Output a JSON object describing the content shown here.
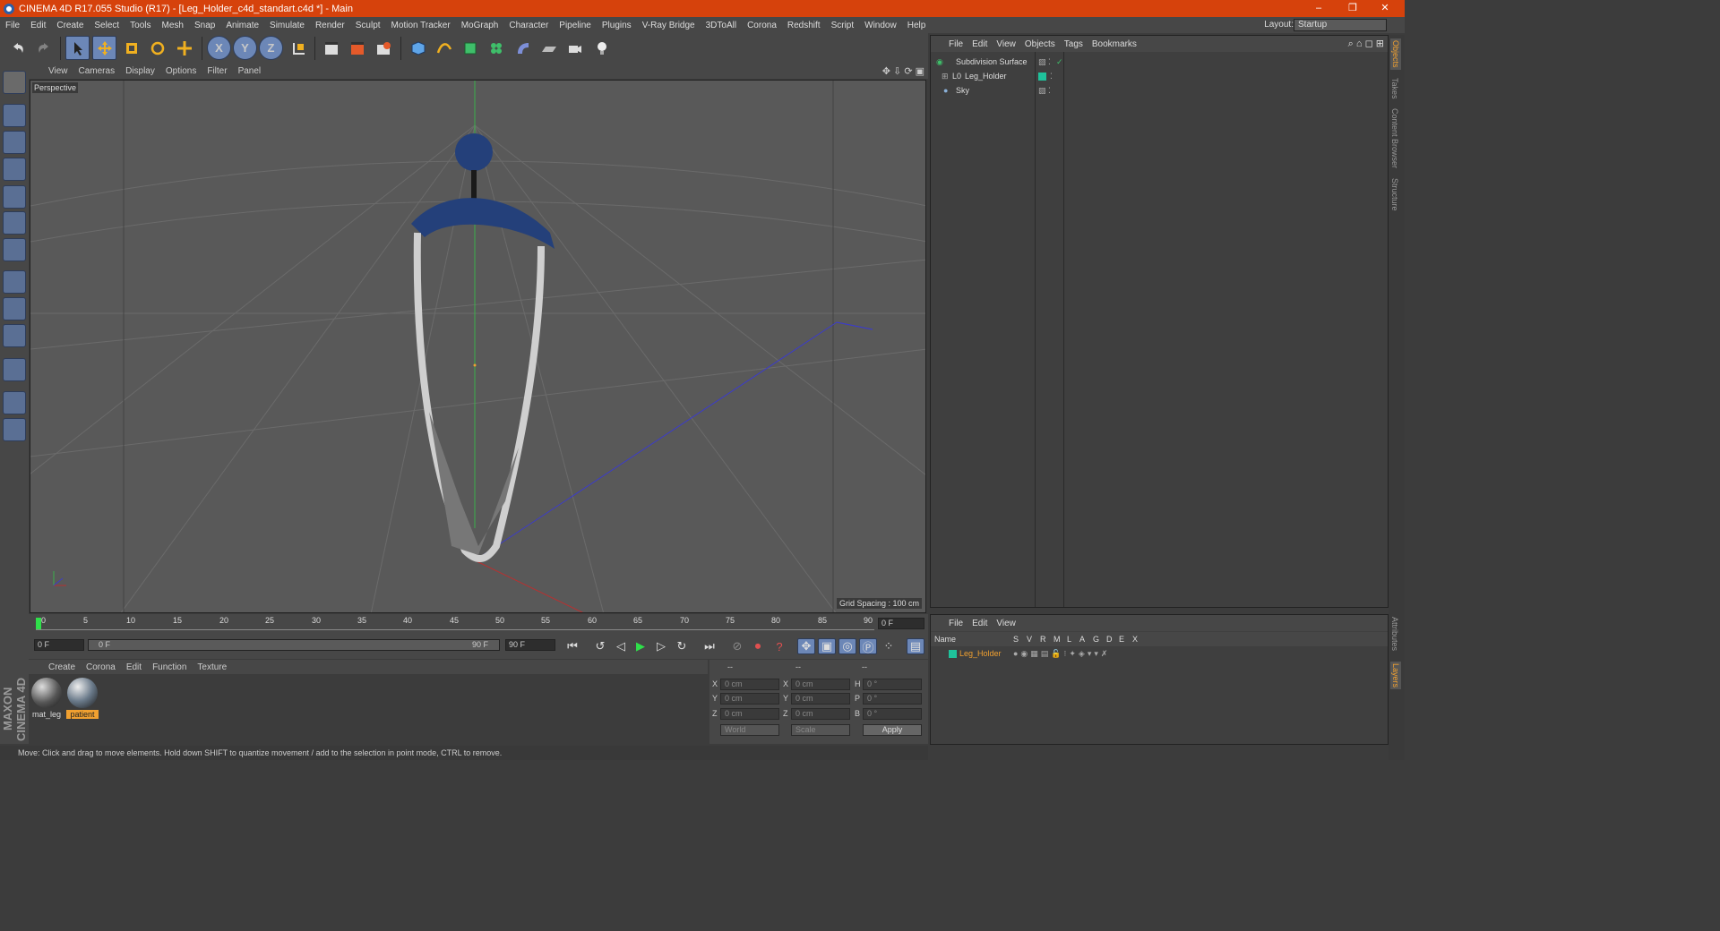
{
  "window": {
    "title": "CINEMA 4D R17.055 Studio (R17) - [Leg_Holder_c4d_standart.c4d *] - Main",
    "minimize": "–",
    "maximize": "❐",
    "close": "✕"
  },
  "menubar": {
    "items": [
      "File",
      "Edit",
      "Create",
      "Select",
      "Tools",
      "Mesh",
      "Snap",
      "Animate",
      "Simulate",
      "Render",
      "Sculpt",
      "Motion Tracker",
      "MoGraph",
      "Character",
      "Pipeline",
      "Plugins",
      "V-Ray Bridge",
      "3DToAll",
      "Corona",
      "Redshift",
      "Script",
      "Window",
      "Help"
    ],
    "layout_label": "Layout:",
    "layout_value": "Startup"
  },
  "toolbar": {
    "axis_x": "X",
    "axis_y": "Y",
    "axis_z": "Z"
  },
  "viewport": {
    "menu": [
      "View",
      "Cameras",
      "Display",
      "Options",
      "Filter",
      "Panel"
    ],
    "label": "Perspective",
    "grid_spacing": "Grid Spacing : 100 cm"
  },
  "timeline": {
    "ticks": [
      "0",
      "5",
      "10",
      "15",
      "20",
      "25",
      "30",
      "35",
      "40",
      "45",
      "50",
      "55",
      "60",
      "65",
      "70",
      "75",
      "80",
      "85",
      "90"
    ],
    "current_frame": "0 F",
    "start": "0 F",
    "range_start": "0 F",
    "range_end": "90 F",
    "end": "90 F"
  },
  "materials": {
    "menu": [
      "Create",
      "Corona",
      "Edit",
      "Function",
      "Texture"
    ],
    "items": [
      {
        "name": "mat_leg",
        "selected": false
      },
      {
        "name": "patient",
        "selected": true
      }
    ]
  },
  "coords": {
    "headers": [
      "--",
      "--",
      "--"
    ],
    "rows": [
      {
        "l1": "X",
        "v1": "0 cm",
        "l2": "X",
        "v2": "0 cm",
        "l3": "H",
        "v3": "0 °"
      },
      {
        "l1": "Y",
        "v1": "0 cm",
        "l2": "Y",
        "v2": "0 cm",
        "l3": "P",
        "v3": "0 °"
      },
      {
        "l1": "Z",
        "v1": "0 cm",
        "l2": "Z",
        "v2": "0 cm",
        "l3": "B",
        "v3": "0 °"
      }
    ],
    "world": "World",
    "scale": "Scale",
    "apply": "Apply"
  },
  "status": "Move: Click and drag to move elements. Hold down SHIFT to quantize movement / add to the selection in point mode, CTRL to remove.",
  "brand": "MAXON CINEMA 4D",
  "objects": {
    "menu": [
      "File",
      "Edit",
      "View",
      "Objects",
      "Tags",
      "Bookmarks"
    ],
    "items": [
      {
        "name": "Subdivision Surface",
        "indent": 0
      },
      {
        "name": "Leg_Holder",
        "indent": 1
      },
      {
        "name": "Sky",
        "indent": 0
      }
    ]
  },
  "layers": {
    "menu": [
      "File",
      "Edit",
      "View"
    ],
    "columns": [
      "Name",
      "S",
      "V",
      "R",
      "M",
      "L",
      "A",
      "G",
      "D",
      "E",
      "X"
    ],
    "items": [
      {
        "name": "Leg_Holder"
      }
    ]
  },
  "side_tabs": [
    "Objects",
    "Takes",
    "Content Browser",
    "Structure"
  ],
  "side_tabs_bottom": [
    "Attributes",
    "Layers"
  ],
  "colors": {
    "accent": "#d6420c",
    "highlight": "#6c87b7",
    "layer_green": "#1fc29b",
    "selected_mat": "#f0a030"
  }
}
